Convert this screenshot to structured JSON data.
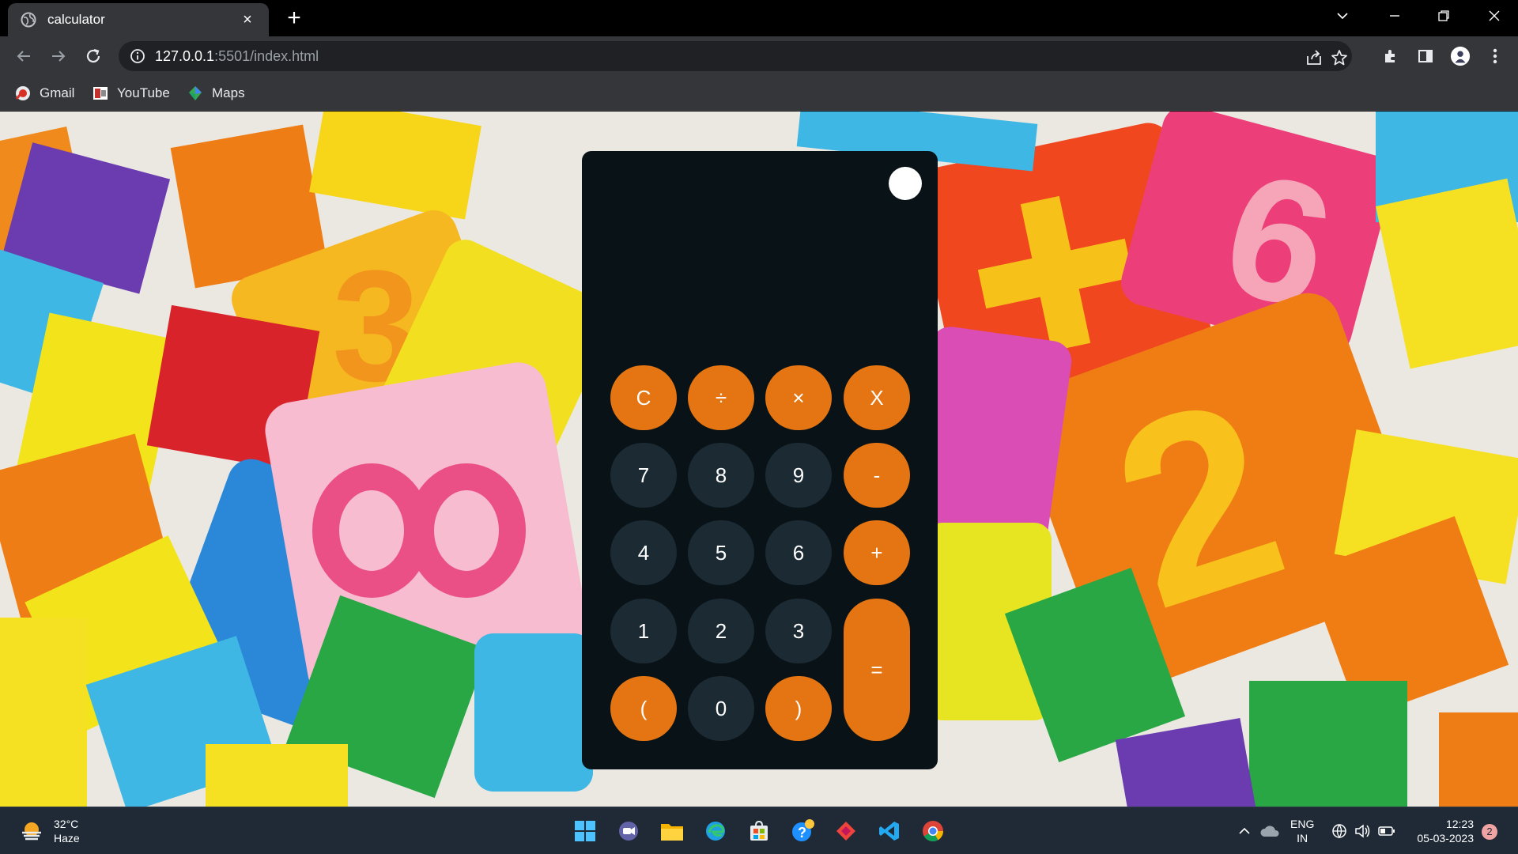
{
  "browser": {
    "tab_title": "calculator",
    "tab_close": "×",
    "new_tab": "+",
    "url_host": "127.0.0.1",
    "url_path": ":5501/index.html",
    "bookmarks": [
      {
        "label": "Gmail"
      },
      {
        "label": "YouTube"
      },
      {
        "label": "Maps"
      }
    ]
  },
  "calculator": {
    "display": "",
    "keys": {
      "clear": "C",
      "divide": "÷",
      "multiply": "×",
      "backspace": "X",
      "seven": "7",
      "eight": "8",
      "nine": "9",
      "minus": "-",
      "four": "4",
      "five": "5",
      "six": "6",
      "plus": "+",
      "one": "1",
      "two": "2",
      "three": "3",
      "equals": "=",
      "open_paren": "(",
      "zero": "0",
      "close_paren": ")"
    },
    "colors": {
      "operator": "#e57512",
      "number": "#1b2a33",
      "panel": "#091217"
    }
  },
  "taskbar": {
    "weather_temp": "32°C",
    "weather_desc": "Haze",
    "lang_top": "ENG",
    "lang_bottom": "IN",
    "time": "12:23",
    "date": "05-03-2023",
    "notifications": "2"
  }
}
